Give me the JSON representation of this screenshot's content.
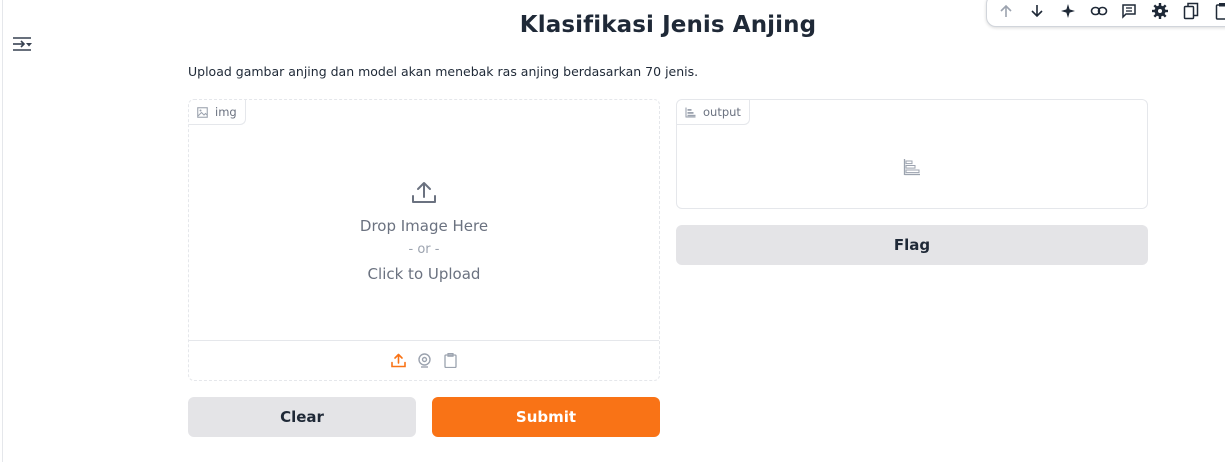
{
  "app": {
    "title": "Klasifikasi Jenis Anjing",
    "description": "Upload gambar anjing dan model akan menebak ras anjing berdasarkan 70 jenis."
  },
  "toolbar": {
    "icons": [
      "arrow-up-icon",
      "arrow-down-icon",
      "sparkle-icon",
      "link-icon",
      "comment-icon",
      "gear-icon",
      "copy-doc-icon",
      "clipboard-icon"
    ]
  },
  "input_panel": {
    "label": "img",
    "label_icon": "image-icon",
    "drop_text": "Drop Image Here",
    "or_text": "- or -",
    "click_text": "Click to Upload",
    "sources": [
      "upload-icon",
      "webcam-icon",
      "clipboard-icon"
    ],
    "active_source_color": "#f97316"
  },
  "output_panel": {
    "label": "output",
    "label_icon": "bar-chart-icon",
    "empty_icon": "bar-chart-icon"
  },
  "buttons": {
    "clear": "Clear",
    "submit": "Submit",
    "flag": "Flag"
  },
  "colors": {
    "primary": "#f97316",
    "secondary": "#e4e4e7",
    "border": "#e5e7eb"
  }
}
